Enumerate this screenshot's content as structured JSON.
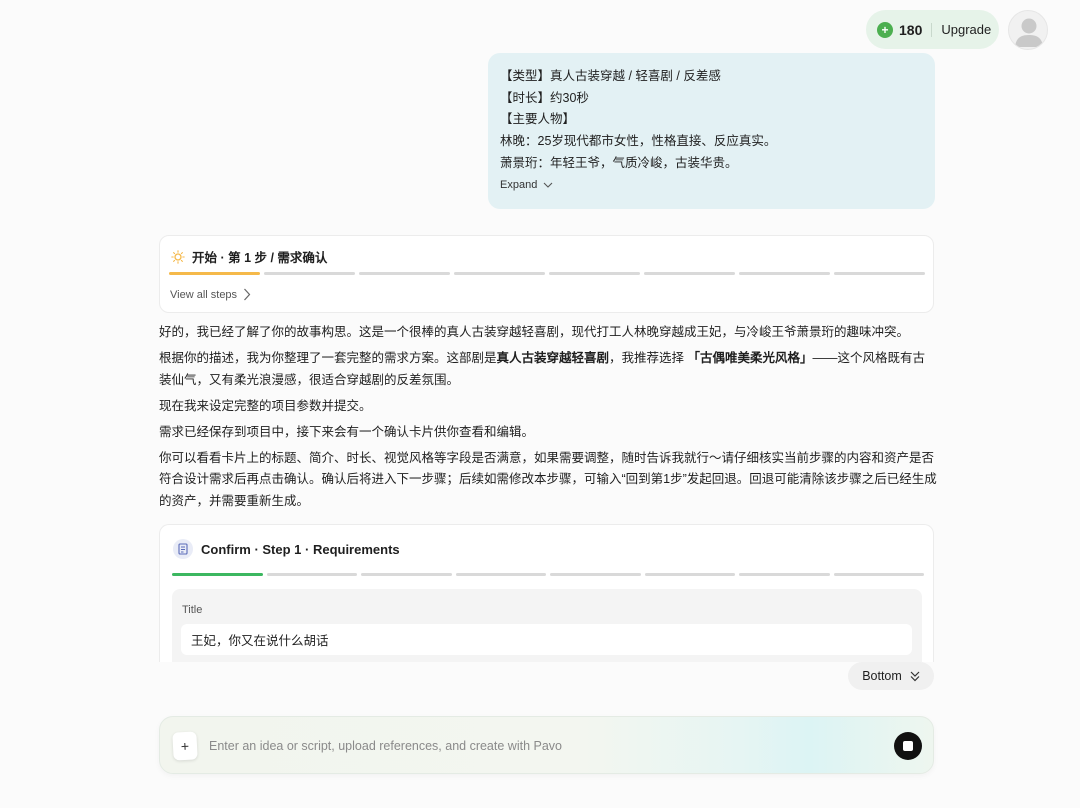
{
  "header": {
    "credits": "180",
    "upgrade_label": "Upgrade",
    "coin_icon_glyph": "+"
  },
  "user_message": {
    "lines": [
      "【类型】真人古装穿越 / 轻喜剧 / 反差感",
      "【时长】约30秒",
      "【主要人物】",
      "林晚：25岁现代都市女性，性格直接、反应真实。",
      "萧景珩：年轻王爷，气质冷峻，古装华贵。"
    ],
    "expand_label": "Expand"
  },
  "step_card": {
    "title": "开始 · 第 1 步 / 需求确认",
    "view_all_label": "View all steps",
    "total_steps": 8,
    "current_step": 1,
    "accent_color": "#f5b94a"
  },
  "assistant": {
    "p1": "好的，我已经了解了你的故事构思。这是一个很棒的真人古装穿越轻喜剧，现代打工人林晚穿越成王妃，与冷峻王爷萧景珩的趣味冲突。",
    "p2_a": "根据你的描述，我为你整理了一套完整的需求方案。这部剧是",
    "p2_b": "真人古装穿越轻喜剧",
    "p2_c": "，我推荐选择 ",
    "p2_d": "「古偶唯美柔光风格」",
    "p2_e": "——这个风格既有古装仙气，又有柔光浪漫感，很适合穿越剧的反差氛围。",
    "p3": "现在我来设定完整的项目参数并提交。",
    "p4": "需求已经保存到项目中，接下来会有一个确认卡片供你查看和编辑。",
    "p5": "你可以看看卡片上的标题、简介、时长、视觉风格等字段是否满意，如果需要调整，随时告诉我就行～请仔细核实当前步骤的内容和资产是否符合设计需求后再点击确认。确认后将进入下一步骤；后续如需修改本步骤，可输入“回到第1步”发起回退。回退可能清除该步骤之后已经生成的资产，并需要重新生成。"
  },
  "confirm_card": {
    "title": "Confirm · Step 1 · Requirements",
    "total_steps": 8,
    "current_step": 1,
    "accent_color": "#3cb760",
    "field_label": "Title",
    "field_value": "王妃，你又在说什么胡话"
  },
  "bottom_button": {
    "label": "Bottom"
  },
  "composer": {
    "placeholder": "Enter an idea or script, upload references, and create with Pavo",
    "plus_label": "+"
  },
  "icons": {
    "coin": "plus-coin-icon",
    "avatar": "user-avatar-icon",
    "expand": "chevron-down-icon",
    "step": "sun-icon",
    "view_steps": "chevron-right-icon",
    "confirm": "document-icon",
    "bottom": "double-chevron-down-icon",
    "stop": "stop-icon"
  }
}
